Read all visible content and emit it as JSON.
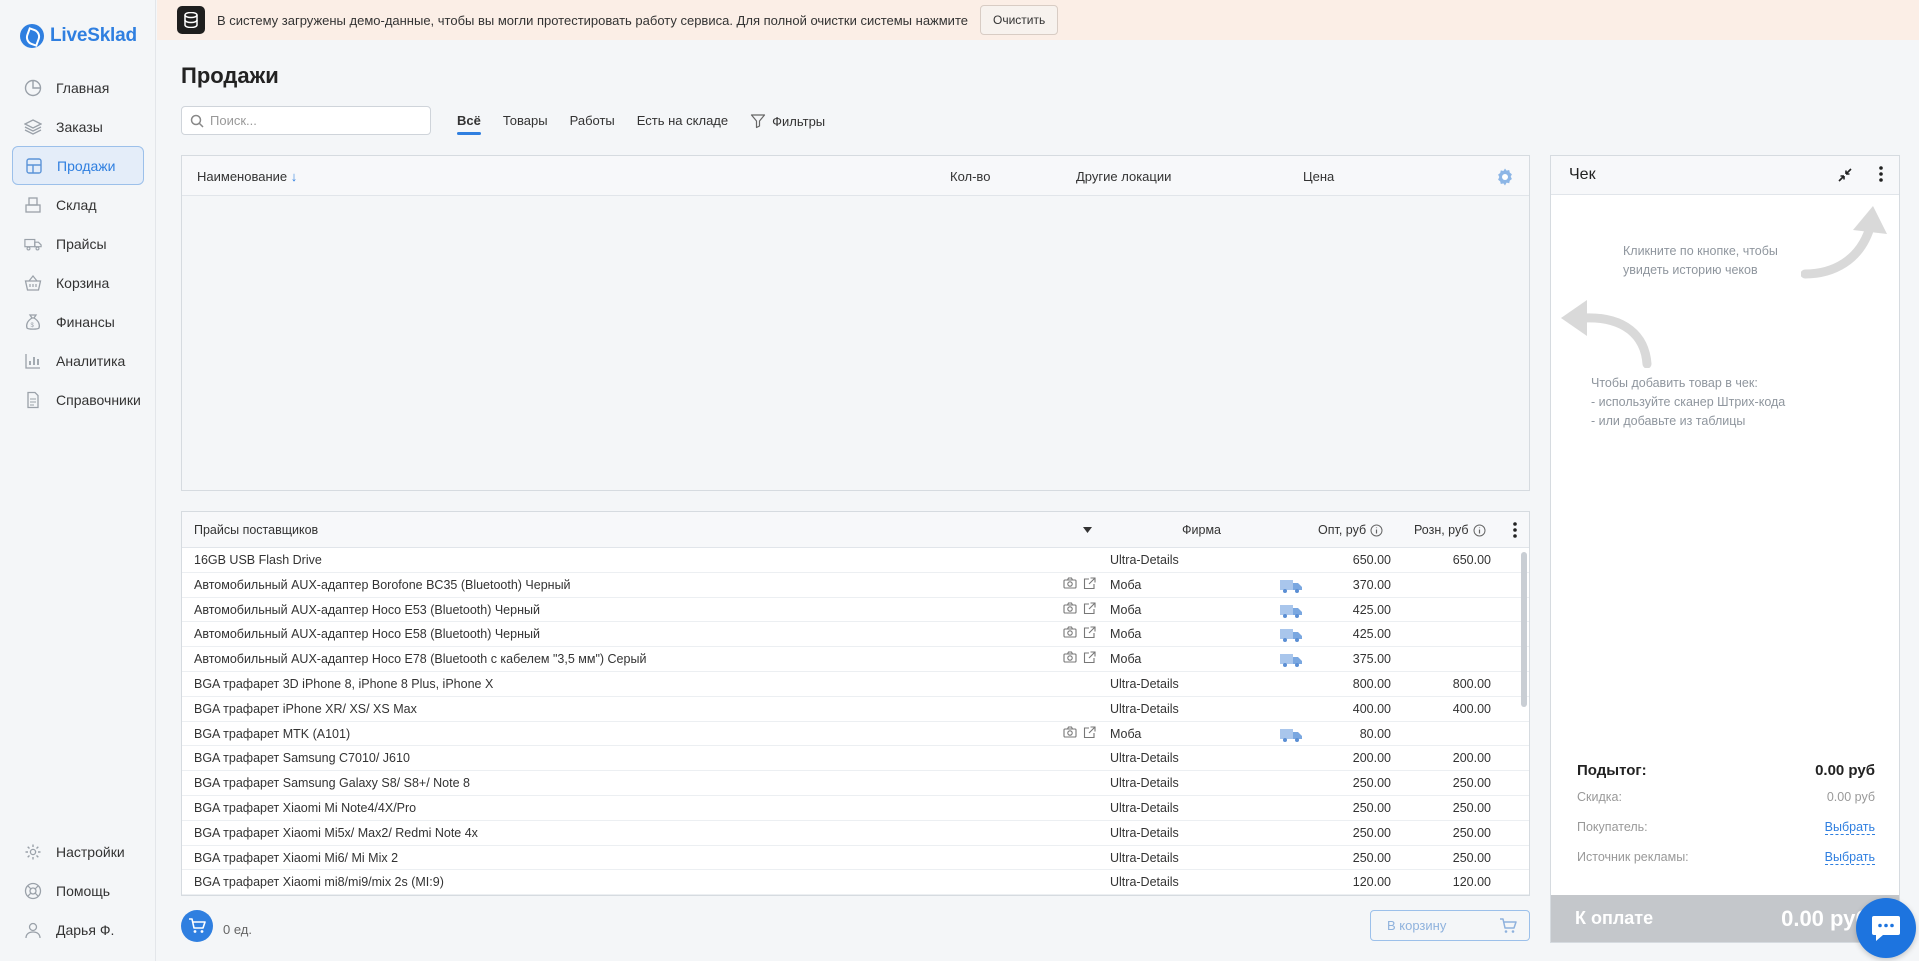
{
  "app": {
    "logo_text": "LiveSklad"
  },
  "sidebar": {
    "items": [
      {
        "label": "Главная",
        "icon": "dashboard-icon"
      },
      {
        "label": "Заказы",
        "icon": "layers-icon"
      },
      {
        "label": "Продажи",
        "icon": "sales-icon",
        "active": true
      },
      {
        "label": "Склад",
        "icon": "warehouse-icon"
      },
      {
        "label": "Прайсы",
        "icon": "truck-icon"
      },
      {
        "label": "Корзина",
        "icon": "basket-icon"
      },
      {
        "label": "Финансы",
        "icon": "money-bag-icon"
      },
      {
        "label": "Аналитика",
        "icon": "chart-icon"
      },
      {
        "label": "Справочники",
        "icon": "document-icon"
      }
    ],
    "bottom_items": [
      {
        "label": "Настройки",
        "icon": "gear-icon"
      },
      {
        "label": "Помощь",
        "icon": "help-icon"
      },
      {
        "label": "Дарья Ф.",
        "icon": "user-icon"
      }
    ]
  },
  "banner": {
    "text": "В систему загружены демо-данные, чтобы вы могли протестировать работу сервиса. Для полной очистки системы нажмите",
    "button": "Очистить"
  },
  "page": {
    "title": "Продажи"
  },
  "search": {
    "placeholder": "Поиск..."
  },
  "tabs": [
    {
      "label": "Всё",
      "active": true
    },
    {
      "label": "Товары"
    },
    {
      "label": "Работы"
    },
    {
      "label": "Есть на складе"
    }
  ],
  "filters_label": "Фильтры",
  "top_table": {
    "headers": {
      "name": "Наименование",
      "qty": "Кол-во",
      "locations": "Другие локации",
      "price": "Цена"
    },
    "sort_indicator": "↓"
  },
  "price_table": {
    "headers": {
      "name": "Прайсы поставщиков",
      "firm": "Фирма",
      "opt": "Опт, руб",
      "rozn": "Розн, руб"
    },
    "rows": [
      {
        "name": "16GB USB Flash Drive",
        "firm": "Ultra-Details",
        "opt": "650.00",
        "rozn": "650.00",
        "icons": false
      },
      {
        "name": "Автомобильный AUX-адаптер Borofone BC35 (Bluetooth) Черный",
        "firm": "Моба",
        "opt": "370.00",
        "rozn": "",
        "icons": true
      },
      {
        "name": "Автомобильный AUX-адаптер Hoco E53 (Bluetooth) Черный",
        "firm": "Моба",
        "opt": "425.00",
        "rozn": "",
        "icons": true
      },
      {
        "name": "Автомобильный AUX-адаптер Hoco E58 (Bluetooth) Черный",
        "firm": "Моба",
        "opt": "425.00",
        "rozn": "",
        "icons": true
      },
      {
        "name": "Автомобильный AUX-адаптер Hoco E78 (Bluetooth с кабелем \"3,5 мм\") Серый",
        "firm": "Моба",
        "opt": "375.00",
        "rozn": "",
        "icons": true
      },
      {
        "name": "BGA трафарет 3D iPhone 8, iPhone 8 Plus, iPhone X",
        "firm": "Ultra-Details",
        "opt": "800.00",
        "rozn": "800.00",
        "icons": false
      },
      {
        "name": "BGA трафарет iPhone XR/ XS/ XS Max",
        "firm": "Ultra-Details",
        "opt": "400.00",
        "rozn": "400.00",
        "icons": false
      },
      {
        "name": "BGA трафарет MTK (A101)",
        "firm": "Моба",
        "opt": "80.00",
        "rozn": "",
        "icons": true
      },
      {
        "name": "BGA трафарет Samsung C7010/ J610",
        "firm": "Ultra-Details",
        "opt": "200.00",
        "rozn": "200.00",
        "icons": false
      },
      {
        "name": "BGA трафарет Samsung Galaxy S8/ S8+/ Note 8",
        "firm": "Ultra-Details",
        "opt": "250.00",
        "rozn": "250.00",
        "icons": false
      },
      {
        "name": "BGA трафарет Xiaomi Mi Note4/4X/Pro",
        "firm": "Ultra-Details",
        "opt": "250.00",
        "rozn": "250.00",
        "icons": false
      },
      {
        "name": "BGA трафарет Xiaomi Mi5x/ Max2/ Redmi Note 4x",
        "firm": "Ultra-Details",
        "opt": "250.00",
        "rozn": "250.00",
        "icons": false
      },
      {
        "name": "BGA трафарет Xiaomi Mi6/ Mi Mix 2",
        "firm": "Ultra-Details",
        "opt": "250.00",
        "rozn": "250.00",
        "icons": false
      },
      {
        "name": "BGA трафарет Xiaomi mi8/mi9/mix 2s (MI:9)",
        "firm": "Ultra-Details",
        "opt": "120.00",
        "rozn": "120.00",
        "icons": false
      }
    ]
  },
  "cart": {
    "count": "0 ед.",
    "button": "В корзину"
  },
  "check": {
    "title": "Чек",
    "hint_history": "Кликните по кнопке, чтобы увидеть историю чеков",
    "hint_add": [
      "Чтобы добавить товар в чек:",
      "- используйте сканер Штрих-кода",
      "- или добавьте из таблицы"
    ],
    "subtotal_label": "Подытог:",
    "subtotal_value": "0.00 руб",
    "discount_label": "Скидка:",
    "discount_value": "0.00 руб",
    "buyer_label": "Покупатель:",
    "buyer_action": "Выбрать",
    "source_label": "Источник рекламы:",
    "source_action": "Выбрать",
    "pay_label": "К оплате",
    "pay_value": "0.00 руб"
  },
  "colors": {
    "accent": "#2f7fe0",
    "banner_bg": "#fbeee6",
    "pay_bg": "#c4c7cb"
  }
}
